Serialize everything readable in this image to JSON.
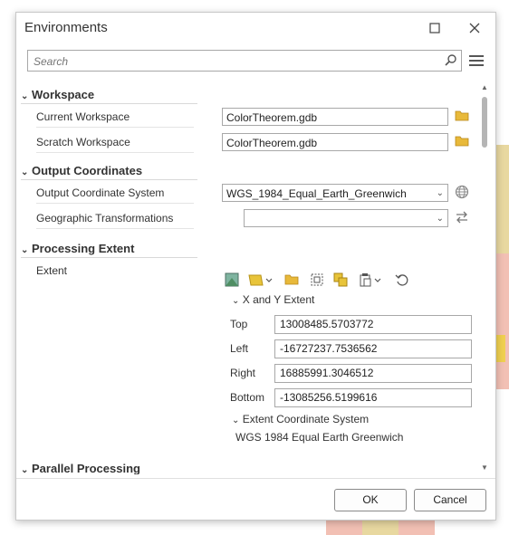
{
  "dialog": {
    "title": "Environments",
    "maximize_icon": "maximize-icon",
    "close_icon": "close-icon"
  },
  "search": {
    "placeholder": "Search",
    "icon": "search-icon",
    "menu_icon": "hamburger-menu-icon"
  },
  "sections": {
    "workspace": {
      "label": "Workspace",
      "current_workspace": {
        "label": "Current Workspace",
        "value": "ColorTheorem.gdb"
      },
      "scratch_workspace": {
        "label": "Scratch Workspace",
        "value": "ColorTheorem.gdb"
      }
    },
    "output_coordinates": {
      "label": "Output Coordinates",
      "output_coordinate_system": {
        "label": "Output Coordinate System",
        "value": "WGS_1984_Equal_Earth_Greenwich"
      },
      "geographic_transformations": {
        "label": "Geographic Transformations",
        "value": ""
      }
    },
    "processing_extent": {
      "label": "Processing Extent",
      "extent": {
        "label": "Extent",
        "xy_group_label": "X and Y Extent",
        "top": {
          "label": "Top",
          "value": "13008485.5703772"
        },
        "left": {
          "label": "Left",
          "value": "-16727237.7536562"
        },
        "right": {
          "label": "Right",
          "value": "16885991.3046512"
        },
        "bottom": {
          "label": "Bottom",
          "value": "-13085256.5199616"
        },
        "coord_group_label": "Extent Coordinate System",
        "coord_value": "WGS 1984 Equal Earth Greenwich"
      }
    },
    "parallel_processing": {
      "label": "Parallel Processing"
    }
  },
  "buttons": {
    "ok": "OK",
    "cancel": "Cancel"
  },
  "colors": {
    "folder": "#e8b93a",
    "globe": "#888888",
    "accent": "#1f6fb5"
  }
}
